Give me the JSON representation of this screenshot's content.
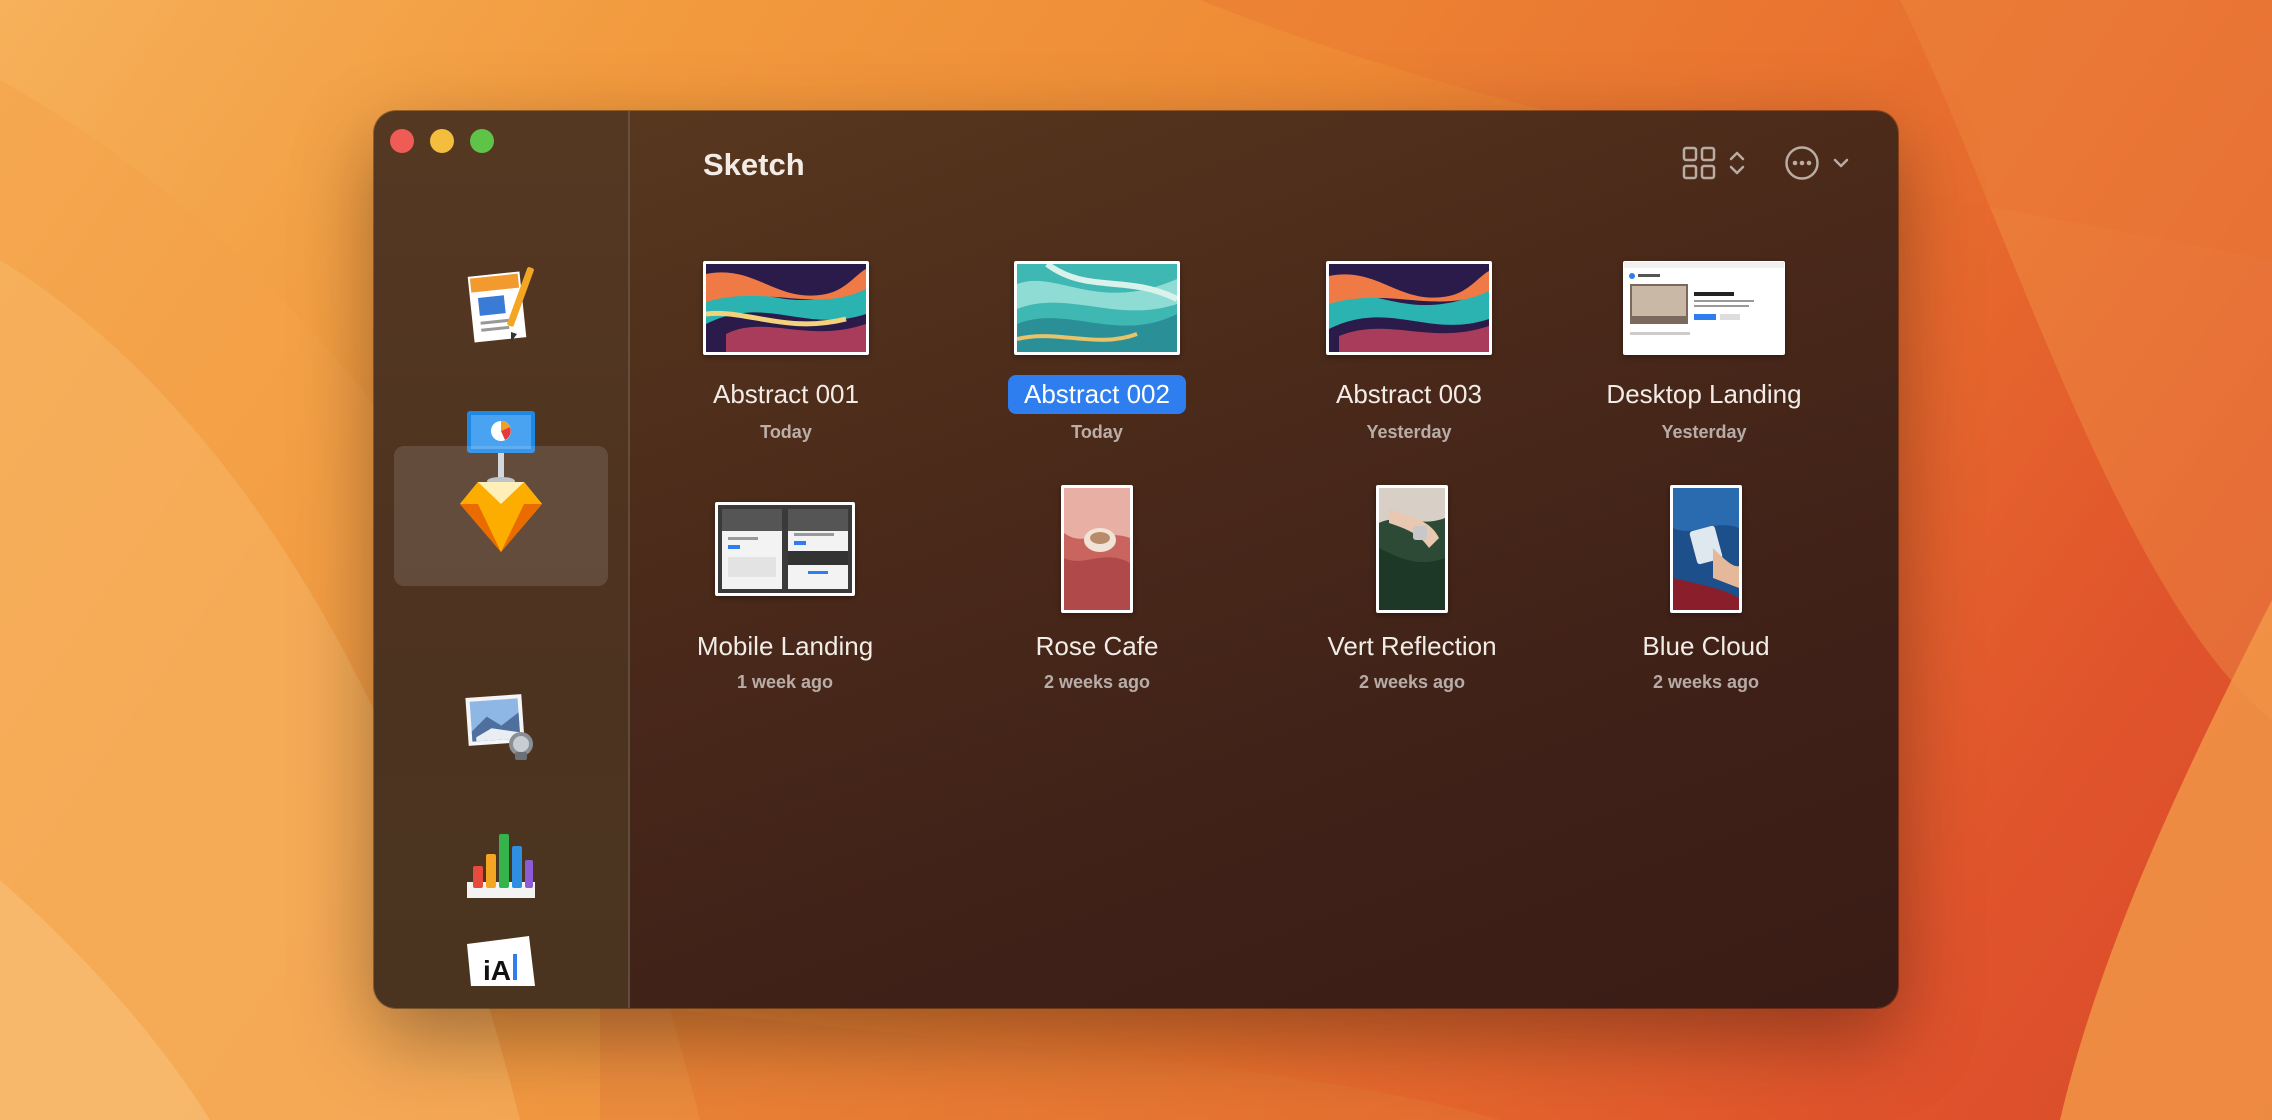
{
  "window": {
    "title": "Sketch"
  },
  "sidebar": {
    "apps": [
      {
        "name": "Pages",
        "icon": "pages-icon",
        "selected": false
      },
      {
        "name": "Keynote",
        "icon": "keynote-icon",
        "selected": false
      },
      {
        "name": "Sketch",
        "icon": "sketch-icon",
        "selected": true
      },
      {
        "name": "Preview",
        "icon": "preview-icon",
        "selected": false
      },
      {
        "name": "Numbers",
        "icon": "numbers-icon",
        "selected": false
      },
      {
        "name": "iA Writer",
        "icon": "ia-writer-icon",
        "selected": false
      }
    ]
  },
  "toolbar": {
    "view_icon": "grid-view-icon",
    "sort_icon": "chevron-updown-icon",
    "more_icon": "ellipsis-circle-icon",
    "menu_icon": "chevron-down-icon"
  },
  "documents": [
    {
      "name": "Abstract 001",
      "date": "Today",
      "selected": false
    },
    {
      "name": "Abstract 002",
      "date": "Today",
      "selected": true
    },
    {
      "name": "Abstract 003",
      "date": "Yesterday",
      "selected": false
    },
    {
      "name": "Desktop Landing",
      "date": "Yesterday",
      "selected": false
    },
    {
      "name": "Mobile Landing",
      "date": "1 week ago",
      "selected": false
    },
    {
      "name": "Rose Cafe",
      "date": "2 weeks ago",
      "selected": false
    },
    {
      "name": "Vert Reflection",
      "date": "2 weeks ago",
      "selected": false
    },
    {
      "name": "Blue Cloud",
      "date": "2 weeks ago",
      "selected": false
    }
  ],
  "colors": {
    "selection": "#2f7ef0",
    "window_bg": "#4b2a1a"
  }
}
